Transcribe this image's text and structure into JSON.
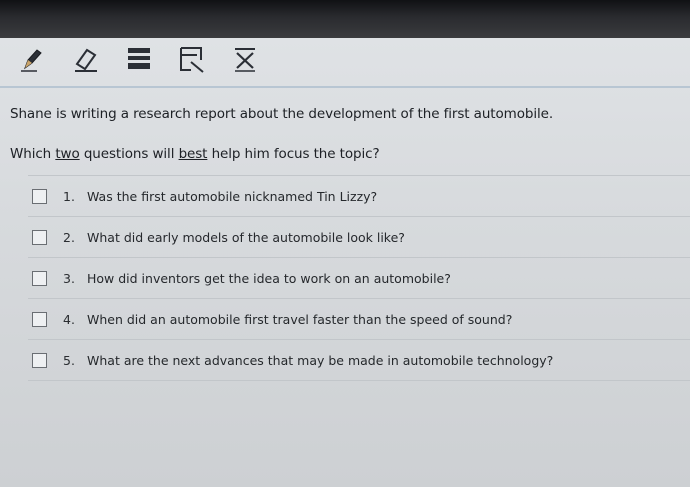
{
  "toolbar": {
    "tools": [
      {
        "icon": "pencil-icon"
      },
      {
        "icon": "eraser-icon"
      },
      {
        "icon": "highlighter-icon"
      },
      {
        "icon": "line-reader-icon"
      },
      {
        "icon": "answer-eliminator-icon"
      }
    ]
  },
  "question": {
    "prompt": "Shane is writing a research report about the development of the first automobile.",
    "stem_part1": "Which ",
    "stem_underline1": "two",
    "stem_part2": " questions will ",
    "stem_underline2": "best",
    "stem_part3": " help him focus the topic?"
  },
  "options": [
    {
      "num": "1.",
      "text": "Was the first automobile nicknamed Tin Lizzy?",
      "checked": false
    },
    {
      "num": "2.",
      "text": "What did early models of the automobile look like?",
      "checked": false
    },
    {
      "num": "3.",
      "text": "How did inventors get the idea to work on an automobile?",
      "checked": false
    },
    {
      "num": "4.",
      "text": "When did an automobile first travel faster than the speed of sound?",
      "checked": false
    },
    {
      "num": "5.",
      "text": "What are the next advances that may be made in automobile technology?",
      "checked": false
    }
  ]
}
